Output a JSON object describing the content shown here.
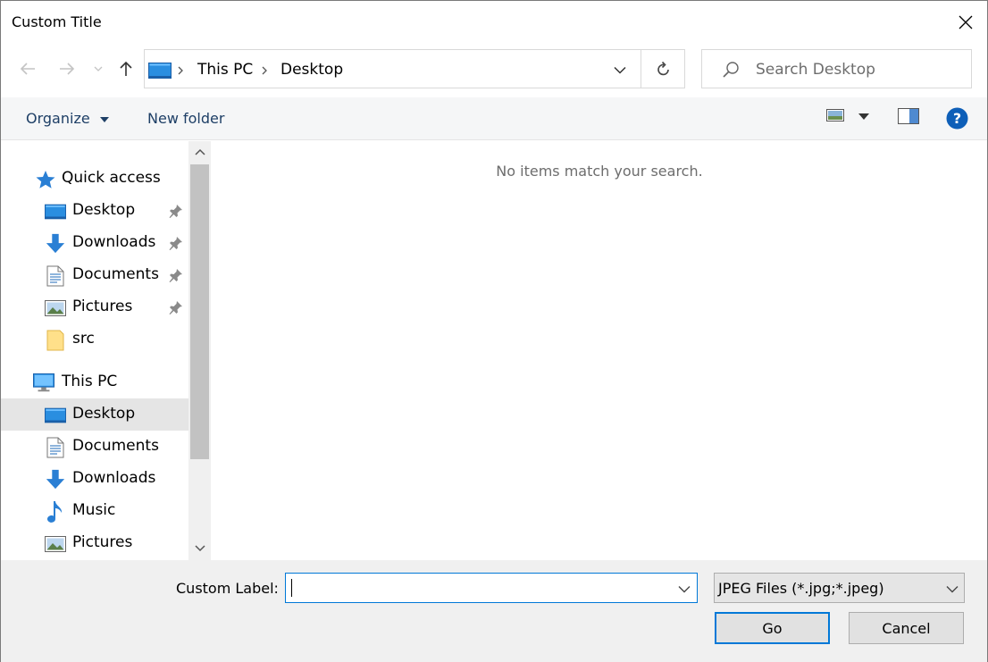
{
  "window": {
    "title": "Custom Title"
  },
  "address": {
    "crumbs": [
      "This PC",
      "Desktop"
    ]
  },
  "search": {
    "placeholder": "Search Desktop"
  },
  "toolbar": {
    "organize": "Organize",
    "new_folder": "New folder"
  },
  "nav": {
    "quick_access": "Quick access",
    "quick_items": [
      {
        "label": "Desktop",
        "icon": "desktop-icon",
        "pinned": true
      },
      {
        "label": "Downloads",
        "icon": "downloads-icon",
        "pinned": true
      },
      {
        "label": "Documents",
        "icon": "documents-icon",
        "pinned": true
      },
      {
        "label": "Pictures",
        "icon": "pictures-icon",
        "pinned": true
      },
      {
        "label": "src",
        "icon": "folder-icon",
        "pinned": false
      }
    ],
    "this_pc": "This PC",
    "pc_items": [
      {
        "label": "Desktop",
        "icon": "desktop-icon",
        "selected": true
      },
      {
        "label": "Documents",
        "icon": "documents-icon"
      },
      {
        "label": "Downloads",
        "icon": "downloads-icon"
      },
      {
        "label": "Music",
        "icon": "music-icon"
      },
      {
        "label": "Pictures",
        "icon": "pictures-icon"
      }
    ]
  },
  "content": {
    "empty_message": "No items match your search."
  },
  "bottom": {
    "filename_label": "Custom Label:",
    "filename_value": "",
    "filetype_value": "JPEG Files (*.jpg;*.jpeg)",
    "go_label": "Go",
    "cancel_label": "Cancel"
  },
  "colors": {
    "accent": "#0078d7",
    "toolbar_text": "#1e3f66",
    "selection": "#e5e5e5"
  }
}
